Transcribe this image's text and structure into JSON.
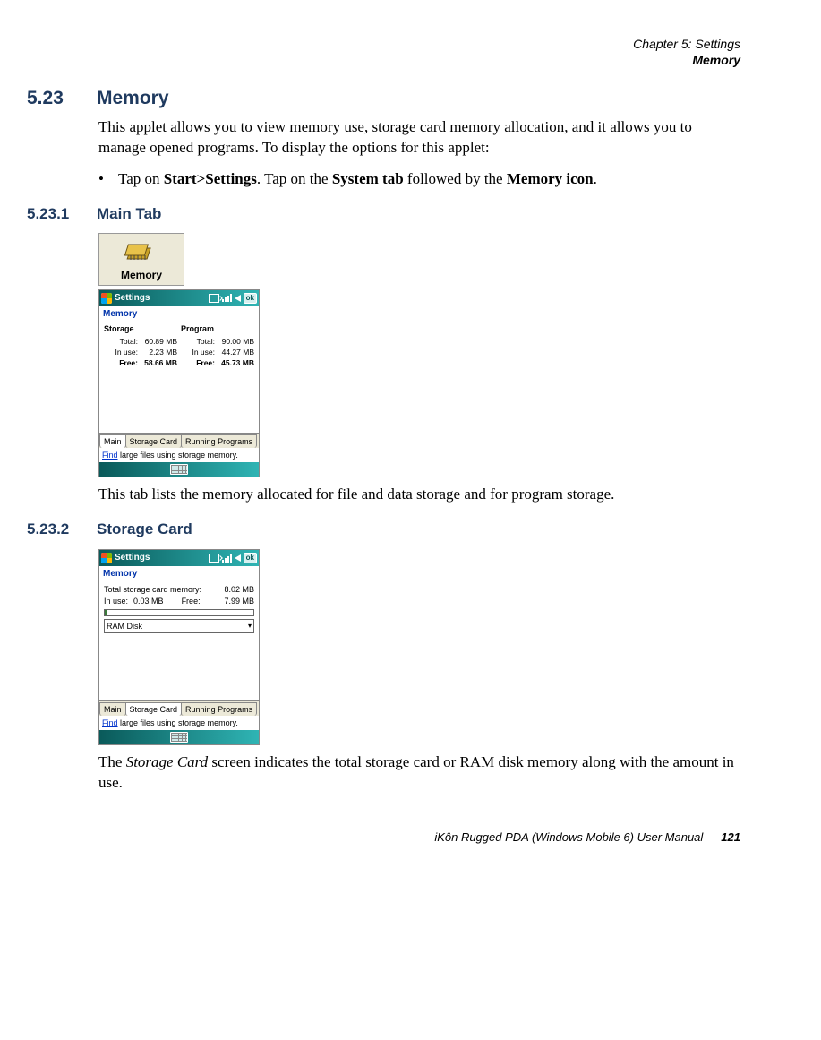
{
  "header": {
    "line1": "Chapter 5:  Settings",
    "line2": "Memory"
  },
  "section": {
    "num": "5.23",
    "title": "Memory",
    "para1": "This applet allows you to view memory use, storage card memory allocation, and it allows you to manage opened programs. To display the options for this applet:",
    "bullet_pre": "Tap on ",
    "bullet_b1": "Start>Settings",
    "bullet_mid1": ". Tap on the ",
    "bullet_b2": "System tab",
    "bullet_mid2": " followed by the ",
    "bullet_b3": "Memory icon",
    "bullet_end": "."
  },
  "sub1": {
    "num": "5.23.1",
    "title": "Main Tab",
    "iconLabel": "Memory",
    "ppc": {
      "titleText": "Settings",
      "ok": "ok",
      "heading": "Memory",
      "storageH": "Storage",
      "programH": "Program",
      "lblTotal": "Total:",
      "lblInUse": "In use:",
      "lblFree": "Free:",
      "sTotal": "60.89 MB",
      "sInUse": "2.23 MB",
      "sFree": "58.66 MB",
      "pTotal": "90.00 MB",
      "pInUse": "44.27 MB",
      "pFree": "45.73 MB",
      "tabs": {
        "main": "Main",
        "sc": "Storage Card",
        "rp": "Running Programs"
      },
      "findLink": "Find",
      "findRest": " large files using storage memory."
    },
    "after": "This tab lists the memory allocated for file and data storage and for program storage."
  },
  "sub2": {
    "num": "5.23.2",
    "title": "Storage Card",
    "ppc": {
      "titleText": "Settings",
      "ok": "ok",
      "heading": "Memory",
      "totalLabel": "Total storage card memory:",
      "totalVal": "8.02 MB",
      "inUseLabel": "In use:",
      "inUseVal": "0.03 MB",
      "freeLabel": "Free:",
      "freeVal": "7.99 MB",
      "dropdown": "RAM Disk",
      "tabs": {
        "main": "Main",
        "sc": "Storage Card",
        "rp": "Running Programs"
      },
      "findLink": "Find",
      "findRest": " large files using storage memory."
    },
    "after_pre": "The ",
    "after_i": "Storage Card",
    "after_post": " screen indicates the total storage card or RAM disk memory along with the amount in use."
  },
  "footer": {
    "text": "iKôn Rugged PDA (Windows Mobile 6) User Manual",
    "page": "121"
  }
}
